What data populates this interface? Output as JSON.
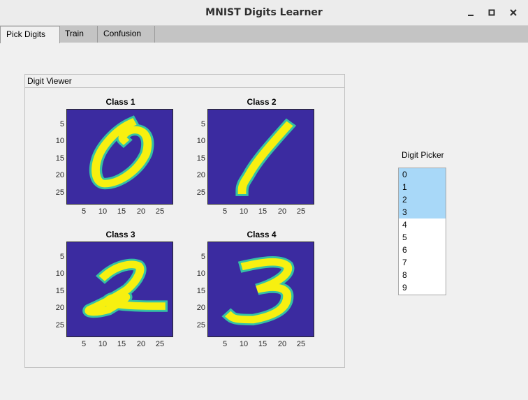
{
  "window": {
    "title": "MNIST Digits Learner"
  },
  "tabs": [
    {
      "label": "Pick Digits",
      "active": true
    },
    {
      "label": "Train",
      "active": false
    },
    {
      "label": "Confusion",
      "active": false
    }
  ],
  "viewer": {
    "title": "Digit Viewer",
    "plots": [
      {
        "title": "Class 1",
        "digit": "0"
      },
      {
        "title": "Class 2",
        "digit": "1"
      },
      {
        "title": "Class 3",
        "digit": "2"
      },
      {
        "title": "Class 4",
        "digit": "3"
      }
    ],
    "yticks": [
      "5",
      "10",
      "15",
      "20",
      "25"
    ],
    "xticks": [
      "5",
      "10",
      "15",
      "20",
      "25"
    ],
    "colors": {
      "background": "#3b2ba0",
      "stroke": "#f7f010",
      "edge": "#36c2a4"
    }
  },
  "picker": {
    "label": "Digit Picker",
    "items": [
      "0",
      "1",
      "2",
      "3",
      "4",
      "5",
      "6",
      "7",
      "8",
      "9"
    ],
    "selected": [
      "0",
      "1",
      "2",
      "3"
    ],
    "selected_color": "#a8d8f8"
  }
}
